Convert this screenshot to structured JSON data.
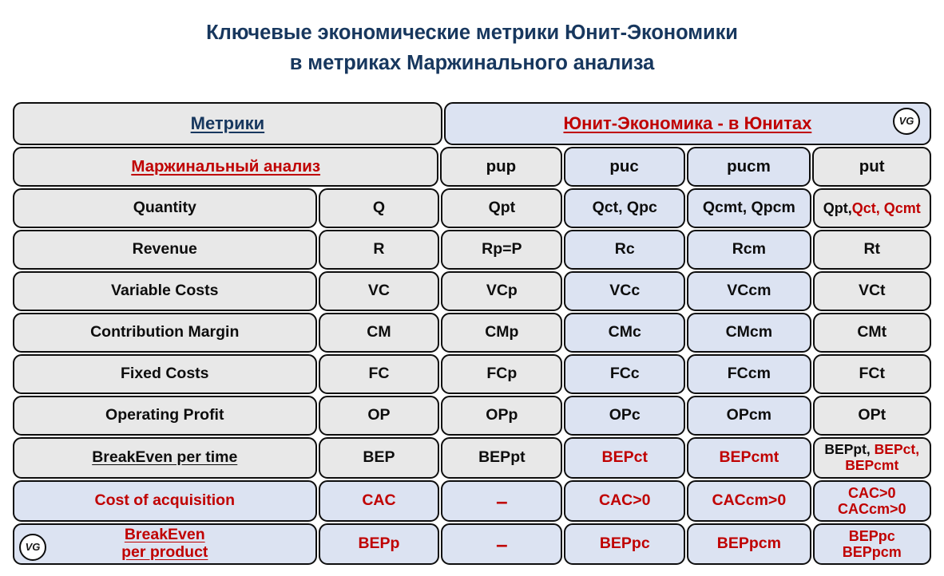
{
  "title": {
    "line1": "Ключевые экономические метрики Юнит-Экономики",
    "line2": "в метриках Маржинального анализа",
    "color": "#17375e"
  },
  "colors": {
    "gray_cell": "#e8e8e8",
    "blue_cell": "#dce3f2",
    "red_text": "#c00000",
    "navy_text": "#17375e",
    "black_text": "#0d0d0d",
    "border": "#0d0d0d"
  },
  "logo": {
    "text": "VG"
  },
  "header": {
    "left_label": "Метрики",
    "right_label": "Юнит-Экономика - в Юнитах"
  },
  "subheader": {
    "label": "Маржинальный анализ",
    "units": [
      "pup",
      "puc",
      "pucm",
      "put"
    ]
  },
  "rows": [
    {
      "name": "Quantity",
      "symbol": "Q",
      "pup": "Qpt",
      "puc": "Qct, Qpc",
      "pucm": "Qcmt, Qpcm",
      "put_black": "Qpt, ",
      "put_red": "Qct, Qcmt"
    },
    {
      "name": "Revenue",
      "symbol": "R",
      "pup": "Rp=P",
      "puc": "Rc",
      "pucm": "Rcm",
      "put": "Rt"
    },
    {
      "name": "Variable Costs",
      "symbol": "VC",
      "pup": "VCp",
      "puc": "VCc",
      "pucm": "VCcm",
      "put": "VCt"
    },
    {
      "name": "Contribution Margin",
      "symbol": "CM",
      "pup": "CMp",
      "puc": "CMc",
      "pucm": "CMcm",
      "put": "CMt"
    },
    {
      "name": "Fixed Costs",
      "symbol": "FC",
      "pup": "FCp",
      "puc": "FCc",
      "pucm": "FCcm",
      "put": "FCt"
    },
    {
      "name": "Operating Profit",
      "symbol": "OP",
      "pup": "OPp",
      "puc": "OPc",
      "pucm": "OPcm",
      "put": "OPt"
    },
    {
      "name": "BreakEven per time",
      "symbol": "BEP",
      "pup": "BEPpt",
      "puc": "BEPct",
      "pucm": "BEPcmt",
      "put_black": "BEPpt, ",
      "put_red": "BEPct, BEPcmt"
    },
    {
      "name": "Cost of acquisition",
      "symbol": "CAC",
      "pup": "–",
      "puc": "CAC>0",
      "pucm": "CACcm>0",
      "put_l1": "CAC>0",
      "put_l2": "CACcm>0"
    },
    {
      "name_l1": "BreakEven",
      "name_l2": "per product",
      "symbol": "BEPp",
      "pup": "–",
      "puc": "BEPpc",
      "pucm": "BEPpcm",
      "put_l1": "BEPpc",
      "put_l2": "BEPpcm"
    }
  ]
}
